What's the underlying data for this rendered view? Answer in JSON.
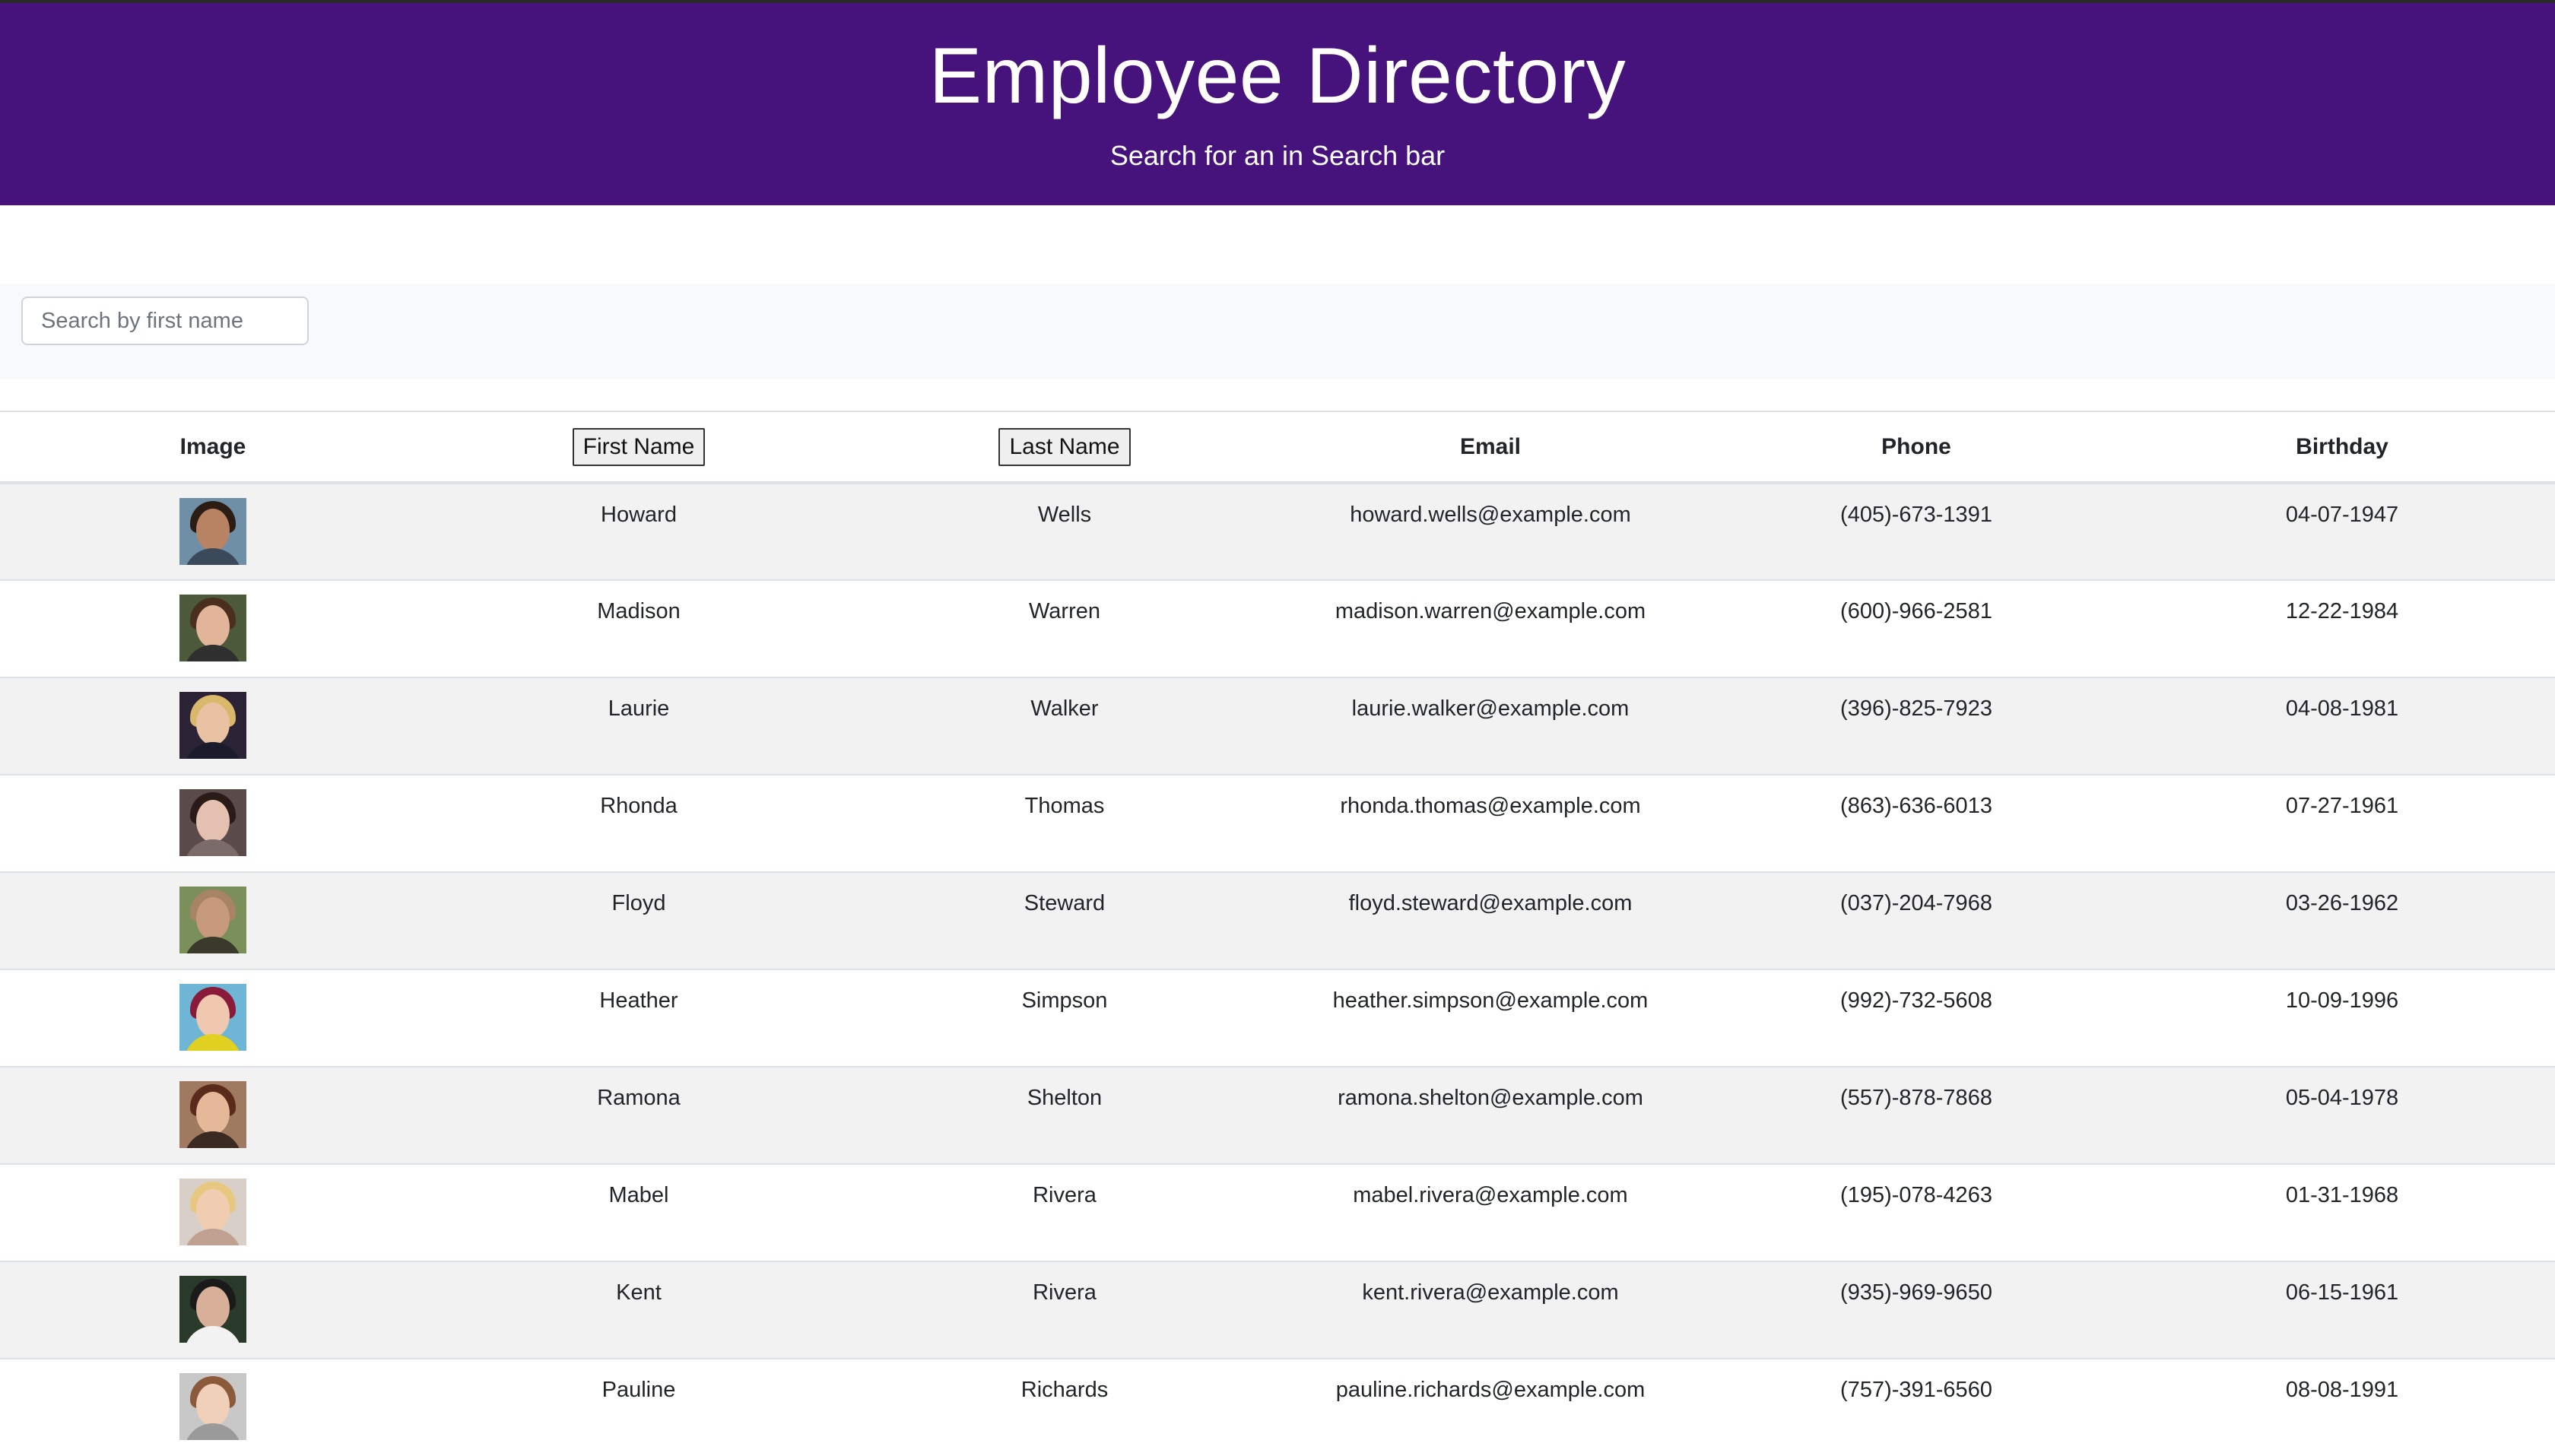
{
  "header": {
    "title": "Employee Directory",
    "subtitle": "Search for an in Search bar"
  },
  "search": {
    "placeholder": "Search by first name",
    "value": ""
  },
  "table": {
    "columns": {
      "image": "Image",
      "first_name": "First Name",
      "last_name": "Last Name",
      "email": "Email",
      "phone": "Phone",
      "birthday": "Birthday"
    },
    "rows": [
      {
        "first": "Howard",
        "last": "Wells",
        "email": "howard.wells@example.com",
        "phone": "(405)-673-1391",
        "birthday": "04-07-1947",
        "avatar": {
          "bg": "#6e8fa6",
          "skin": "#b88362",
          "hair": "#2b1d14",
          "shirt": "#3b4a5a"
        }
      },
      {
        "first": "Madison",
        "last": "Warren",
        "email": "madison.warren@example.com",
        "phone": "(600)-966-2581",
        "birthday": "12-22-1984",
        "avatar": {
          "bg": "#4c5a3a",
          "skin": "#e2b59a",
          "hair": "#4a2f1f",
          "shirt": "#2f2f2f"
        }
      },
      {
        "first": "Laurie",
        "last": "Walker",
        "email": "laurie.walker@example.com",
        "phone": "(396)-825-7923",
        "birthday": "04-08-1981",
        "avatar": {
          "bg": "#2b2236",
          "skin": "#e8c2a2",
          "hair": "#d9b86b",
          "shirt": "#1b1b2b"
        }
      },
      {
        "first": "Rhonda",
        "last": "Thomas",
        "email": "rhonda.thomas@example.com",
        "phone": "(863)-636-6013",
        "birthday": "07-27-1961",
        "avatar": {
          "bg": "#5a4a4a",
          "skin": "#e4c0b0",
          "hair": "#2a1a18",
          "shirt": "#7a6a6a"
        }
      },
      {
        "first": "Floyd",
        "last": "Steward",
        "email": "floyd.steward@example.com",
        "phone": "(037)-204-7968",
        "birthday": "03-26-1962",
        "avatar": {
          "bg": "#7a8f5a",
          "skin": "#c69a7a",
          "hair": "#a88466",
          "shirt": "#3a3a2a"
        }
      },
      {
        "first": "Heather",
        "last": "Simpson",
        "email": "heather.simpson@example.com",
        "phone": "(992)-732-5608",
        "birthday": "10-09-1996",
        "avatar": {
          "bg": "#6fb6d6",
          "skin": "#f0c8b0",
          "hair": "#8a1a3a",
          "shirt": "#e0d020"
        }
      },
      {
        "first": "Ramona",
        "last": "Shelton",
        "email": "ramona.shelton@example.com",
        "phone": "(557)-878-7868",
        "birthday": "05-04-1978",
        "avatar": {
          "bg": "#a07a60",
          "skin": "#e6b89a",
          "hair": "#5a2a1a",
          "shirt": "#3a2a22"
        }
      },
      {
        "first": "Mabel",
        "last": "Rivera",
        "email": "mabel.rivera@example.com",
        "phone": "(195)-078-4263",
        "birthday": "01-31-1968",
        "avatar": {
          "bg": "#d8d0c8",
          "skin": "#f0cdb0",
          "hair": "#e8c880",
          "shirt": "#c0a090"
        }
      },
      {
        "first": "Kent",
        "last": "Rivera",
        "email": "kent.rivera@example.com",
        "phone": "(935)-969-9650",
        "birthday": "06-15-1961",
        "avatar": {
          "bg": "#2a3a2a",
          "skin": "#d8b09a",
          "hair": "#1a1a1a",
          "shirt": "#f2f2f2"
        }
      },
      {
        "first": "Pauline",
        "last": "Richards",
        "email": "pauline.richards@example.com",
        "phone": "(757)-391-6560",
        "birthday": "08-08-1991",
        "avatar": {
          "bg": "#c8c8c8",
          "skin": "#f0d0b8",
          "hair": "#8a5a3a",
          "shirt": "#9a9a9a"
        }
      }
    ]
  }
}
